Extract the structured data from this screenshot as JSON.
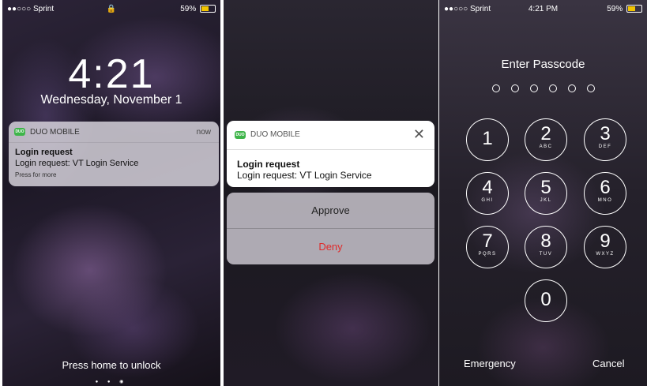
{
  "panel1": {
    "status": {
      "carrier": "●●○○○ Sprint",
      "wifi": "wifi-icon",
      "lock": "🔒",
      "battery": "59%"
    },
    "time": "4:21",
    "date": "Wednesday, November 1",
    "notification": {
      "app_icon": "DUO",
      "app": "DUO MOBILE",
      "time": "now",
      "title": "Login request",
      "body": "Login request: VT Login Service",
      "hint": "Press for more"
    },
    "unlock_text": "Press home to unlock",
    "page_dots": "● ● ◉"
  },
  "panel2": {
    "card": {
      "app_icon": "DUO",
      "app": "DUO MOBILE",
      "close": "✕",
      "title": "Login request",
      "body": "Login request: VT Login Service"
    },
    "approve_label": "Approve",
    "deny_label": "Deny"
  },
  "panel3": {
    "status": {
      "carrier": "●●○○○ Sprint",
      "time": "4:21 PM",
      "battery": "59%"
    },
    "title": "Enter Passcode",
    "keys": [
      {
        "n": "1",
        "s": ""
      },
      {
        "n": "2",
        "s": "ABC"
      },
      {
        "n": "3",
        "s": "DEF"
      },
      {
        "n": "4",
        "s": "GHI"
      },
      {
        "n": "5",
        "s": "JKL"
      },
      {
        "n": "6",
        "s": "MNO"
      },
      {
        "n": "7",
        "s": "PQRS"
      },
      {
        "n": "8",
        "s": "TUV"
      },
      {
        "n": "9",
        "s": "WXYZ"
      },
      {
        "n": "0",
        "s": ""
      }
    ],
    "emergency_label": "Emergency",
    "cancel_label": "Cancel"
  },
  "colors": {
    "battery": "#f2c400",
    "duo_green": "#3fb54a",
    "deny_red": "#e02a2a"
  }
}
